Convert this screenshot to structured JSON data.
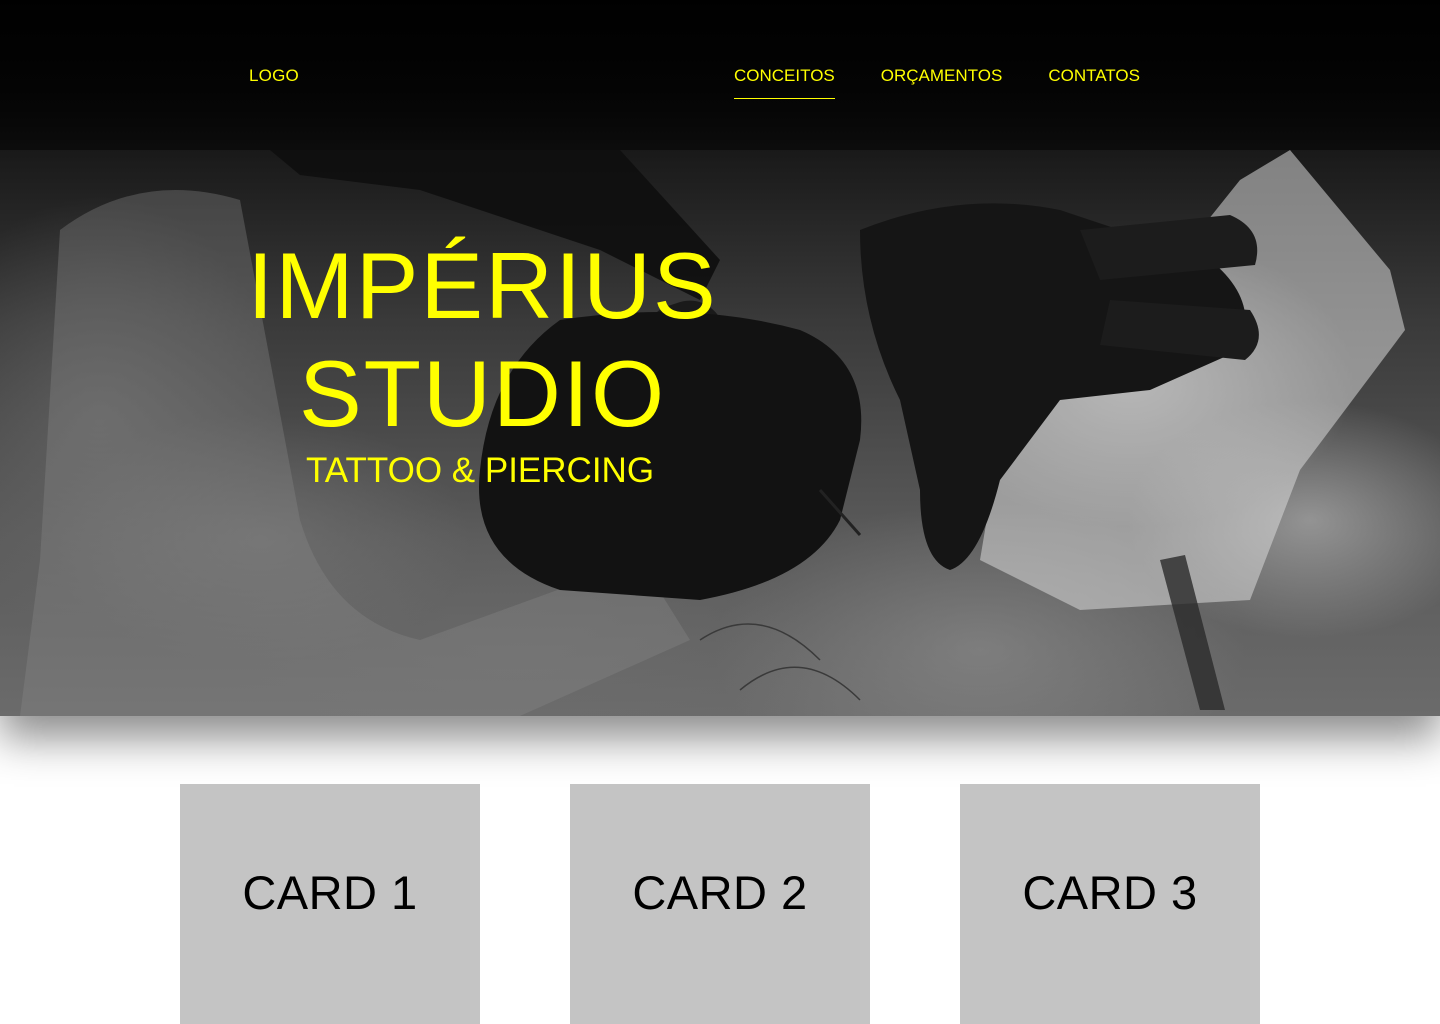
{
  "header": {
    "logo": "LOGO",
    "nav": [
      {
        "label": "CONCEITOS",
        "active": true
      },
      {
        "label": "ORÇAMENTOS",
        "active": false
      },
      {
        "label": "CONTATOS",
        "active": false
      }
    ]
  },
  "hero": {
    "title_line1": "IMPÉRIUS",
    "title_line2": "STUDIO",
    "subtitle": "TATTOO & PIERCING",
    "background": "black-and-white photo of gloved hands tattooing"
  },
  "cards": [
    {
      "label": "CARD 1"
    },
    {
      "label": "CARD 2"
    },
    {
      "label": "CARD 3"
    }
  ],
  "colors": {
    "accent": "#ffff00",
    "card_bg": "#c4c4c4",
    "card_text": "#000000"
  }
}
